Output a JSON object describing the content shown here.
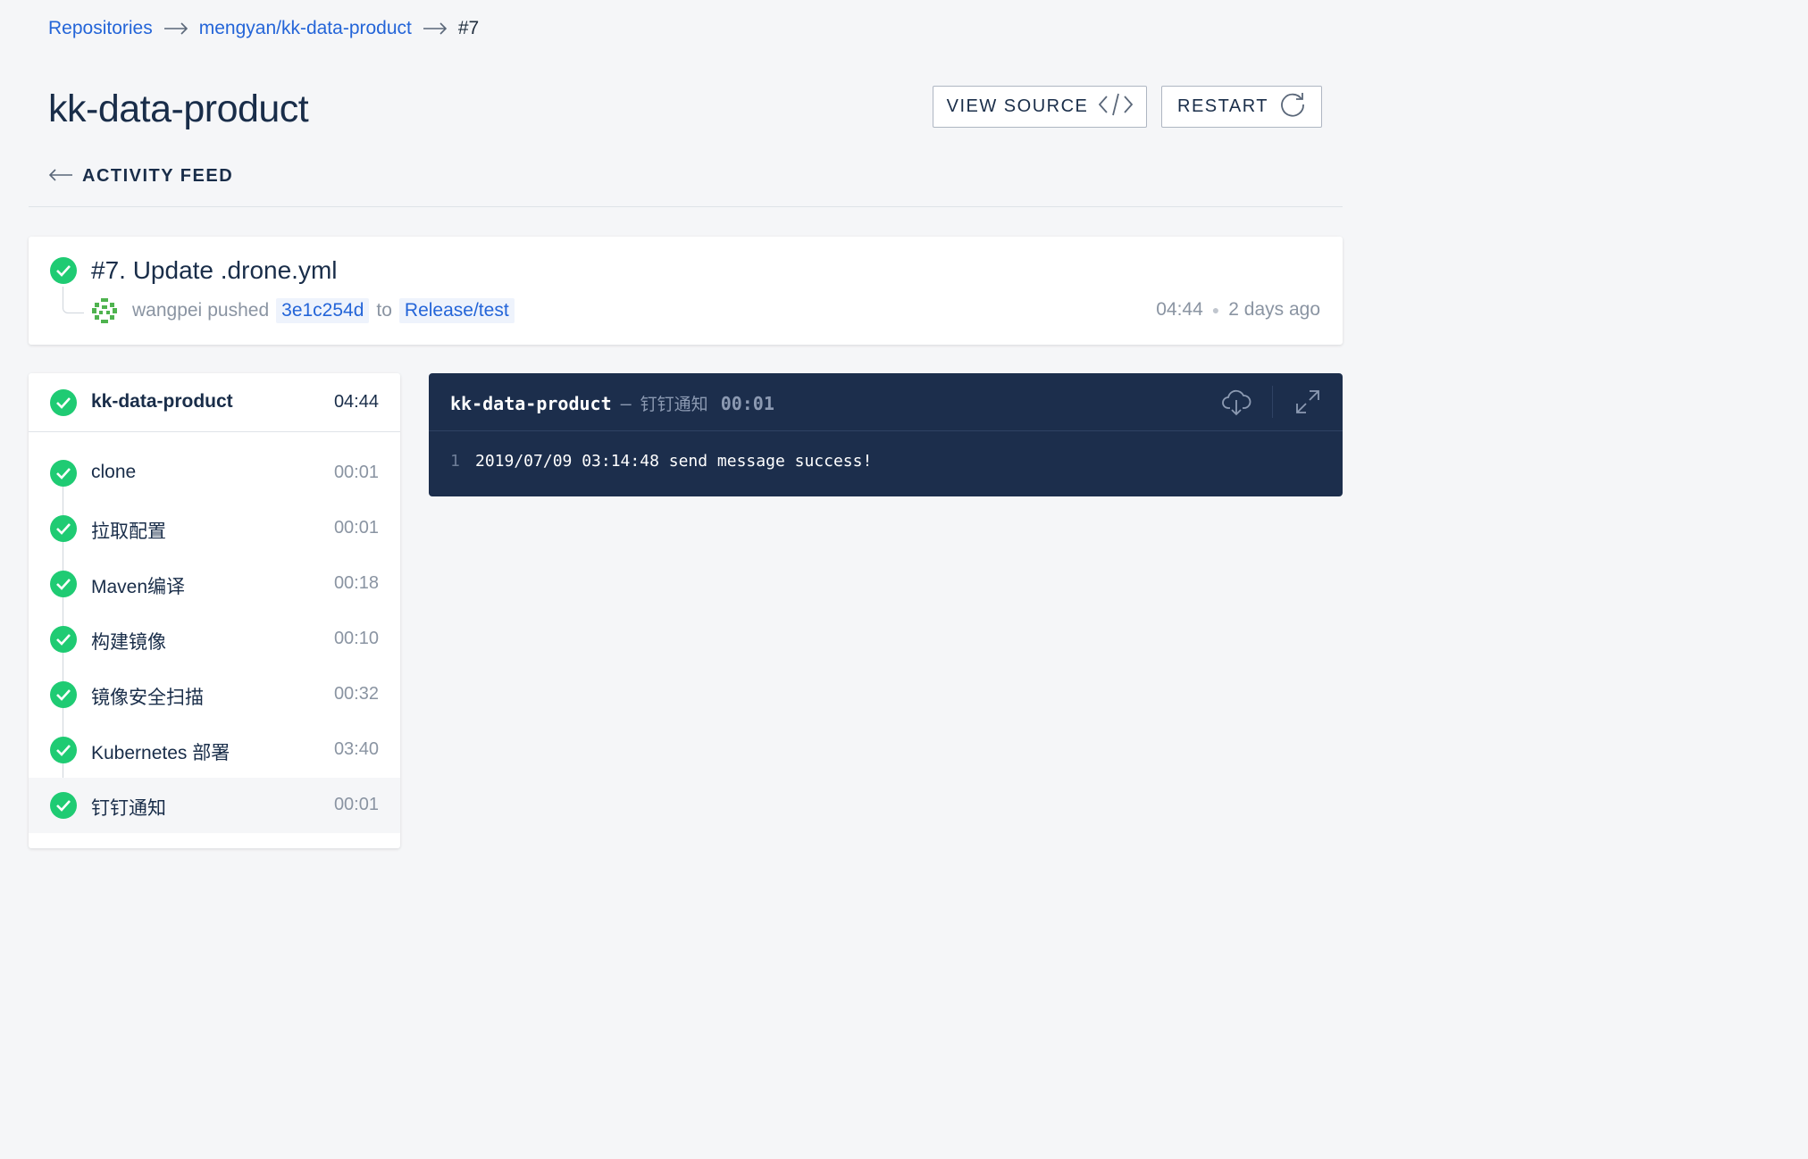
{
  "breadcrumb": {
    "repositories": "Repositories",
    "repo": "mengyan/kk-data-product",
    "build": "#7"
  },
  "page": {
    "title": "kk-data-product"
  },
  "actions": {
    "view_source": "VIEW SOURCE",
    "restart": "RESTART"
  },
  "activity_feed": "ACTIVITY FEED",
  "build": {
    "title": "#7. Update .drone.yml",
    "author": "wangpei",
    "action": "pushed",
    "commit": "3e1c254d",
    "to": "to",
    "branch": "Release/test",
    "duration": "04:44",
    "ago": "2 days ago"
  },
  "stage": {
    "name": "kk-data-product",
    "duration": "04:44",
    "steps": [
      {
        "name": "clone",
        "duration": "00:01"
      },
      {
        "name": "拉取配置",
        "duration": "00:01"
      },
      {
        "name": "Maven编译",
        "duration": "00:18"
      },
      {
        "name": "构建镜像",
        "duration": "00:10"
      },
      {
        "name": "镜像安全扫描",
        "duration": "00:32"
      },
      {
        "name": "Kubernetes 部署",
        "duration": "03:40"
      },
      {
        "name": "钉钉通知",
        "duration": "00:01"
      }
    ]
  },
  "log": {
    "stage": "kk-data-product",
    "dash": "—",
    "step": "钉钉通知",
    "duration": "00:01",
    "lines": [
      {
        "num": "1",
        "text": "2019/07/09 03:14:48 send message success!"
      }
    ]
  },
  "colors": {
    "success": "#1fcb73",
    "link": "#2465d8",
    "log_bg": "#1c2e4c"
  }
}
